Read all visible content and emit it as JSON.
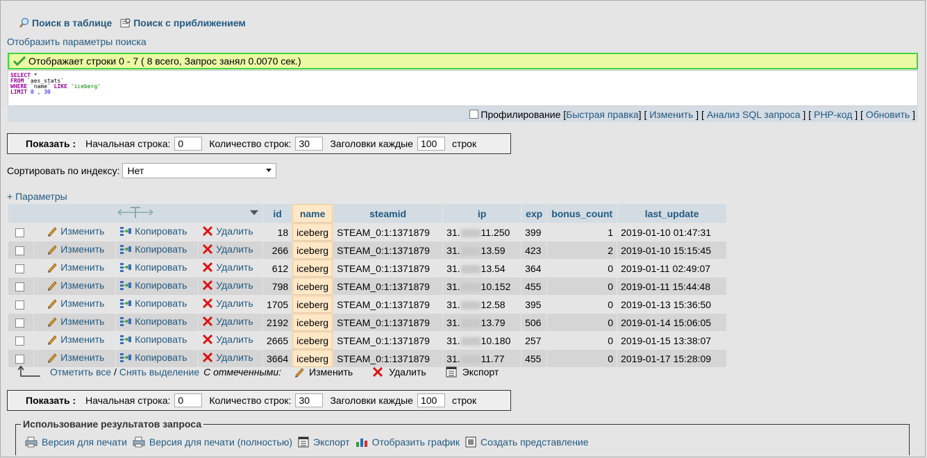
{
  "topnav": {
    "search_table": "Поиск в таблице",
    "search_zoom": "Поиск с приближением"
  },
  "show_search_params": "Отобразить параметры поиска",
  "success_message": "Отображает строки 0 - 7 ( 8 всего, Запрос занял 0.0070 сек.)",
  "sql": {
    "select": "SELECT",
    "star": "*",
    "from": "FROM",
    "table": "`aes_stats`",
    "where": "WHERE",
    "col": "`name`",
    "like": "LIKE",
    "value": "'iceberg'",
    "limit": "LIMIT",
    "limit_vals": "0 , 30"
  },
  "sqlbar": {
    "profiling": "Профилирование",
    "quick_edit": "Быстрая правка",
    "edit": "Изменить",
    "analyze": "Анализ SQL запроса",
    "php": "PHP-код",
    "refresh": "Обновить"
  },
  "nav": {
    "show": "Показать :",
    "start_row_label": "Начальная строка:",
    "start_row": "0",
    "count_label": "Количество строк:",
    "count": "30",
    "headers_label": "Заголовки каждые",
    "headers": "100",
    "rows_word": "строк"
  },
  "sort": {
    "label": "Сортировать по индексу:",
    "value": "Нет"
  },
  "params_link": "+ Параметры",
  "table": {
    "columns": [
      "id",
      "name",
      "steamid",
      "ip",
      "exp",
      "bonus_count",
      "last_update"
    ],
    "actions": {
      "edit": "Изменить",
      "copy": "Копировать",
      "delete": "Удалить"
    },
    "rows": [
      {
        "id": "18",
        "name": "iceberg",
        "steamid": "STEAM_0:1:1371879",
        "ip_pre": "31.",
        "ip_post": "11.250",
        "exp": "399",
        "bonus": "1",
        "updated": "2019-01-10 01:47:31"
      },
      {
        "id": "266",
        "name": "iceberg",
        "steamid": "STEAM_0:1:1371879",
        "ip_pre": "31.",
        "ip_post": "13.59",
        "exp": "423",
        "bonus": "2",
        "updated": "2019-01-10 15:15:45"
      },
      {
        "id": "612",
        "name": "iceberg",
        "steamid": "STEAM_0:1:1371879",
        "ip_pre": "31.",
        "ip_post": "13.54",
        "exp": "364",
        "bonus": "0",
        "updated": "2019-01-11 02:49:07"
      },
      {
        "id": "798",
        "name": "iceberg",
        "steamid": "STEAM_0:1:1371879",
        "ip_pre": "31.",
        "ip_post": "10.152",
        "exp": "455",
        "bonus": "0",
        "updated": "2019-01-11 15:44:48"
      },
      {
        "id": "1705",
        "name": "iceberg",
        "steamid": "STEAM_0:1:1371879",
        "ip_pre": "31.",
        "ip_post": "12.58",
        "exp": "395",
        "bonus": "0",
        "updated": "2019-01-13 15:36:50"
      },
      {
        "id": "2192",
        "name": "iceberg",
        "steamid": "STEAM_0:1:1371879",
        "ip_pre": "31.",
        "ip_post": "13.79",
        "exp": "506",
        "bonus": "0",
        "updated": "2019-01-14 15:06:05"
      },
      {
        "id": "2665",
        "name": "iceberg",
        "steamid": "STEAM_0:1:1371879",
        "ip_pre": "31.",
        "ip_post": "10.180",
        "exp": "257",
        "bonus": "0",
        "updated": "2019-01-15 13:38:07"
      },
      {
        "id": "3664",
        "name": "iceberg",
        "steamid": "STEAM_0:1:1371879",
        "ip_pre": "31.",
        "ip_post": "11.77",
        "exp": "455",
        "bonus": "0",
        "updated": "2019-01-17 15:28:09"
      }
    ]
  },
  "bulk": {
    "check_all": "Отметить все",
    "separator": "/",
    "uncheck_all": "Снять выделение",
    "with_selected": "С отмеченными:",
    "edit": "Изменить",
    "delete": "Удалить",
    "export": "Экспорт"
  },
  "query_results": {
    "legend": "Использование результатов запроса",
    "print": "Версия для печати",
    "print_full": "Версия для печати (полностью)",
    "export": "Экспорт",
    "chart": "Отобразить график",
    "create_view": "Создать представление"
  },
  "icons": {
    "search": "magnifier-icon",
    "zoom": "zoom-search-icon",
    "check": "check-icon",
    "pencil": "pencil-icon",
    "copy": "copy-icon",
    "delete": "delete-x-icon",
    "print": "printer-icon",
    "export": "export-icon",
    "chart": "bar-chart-icon",
    "view": "view-icon"
  }
}
